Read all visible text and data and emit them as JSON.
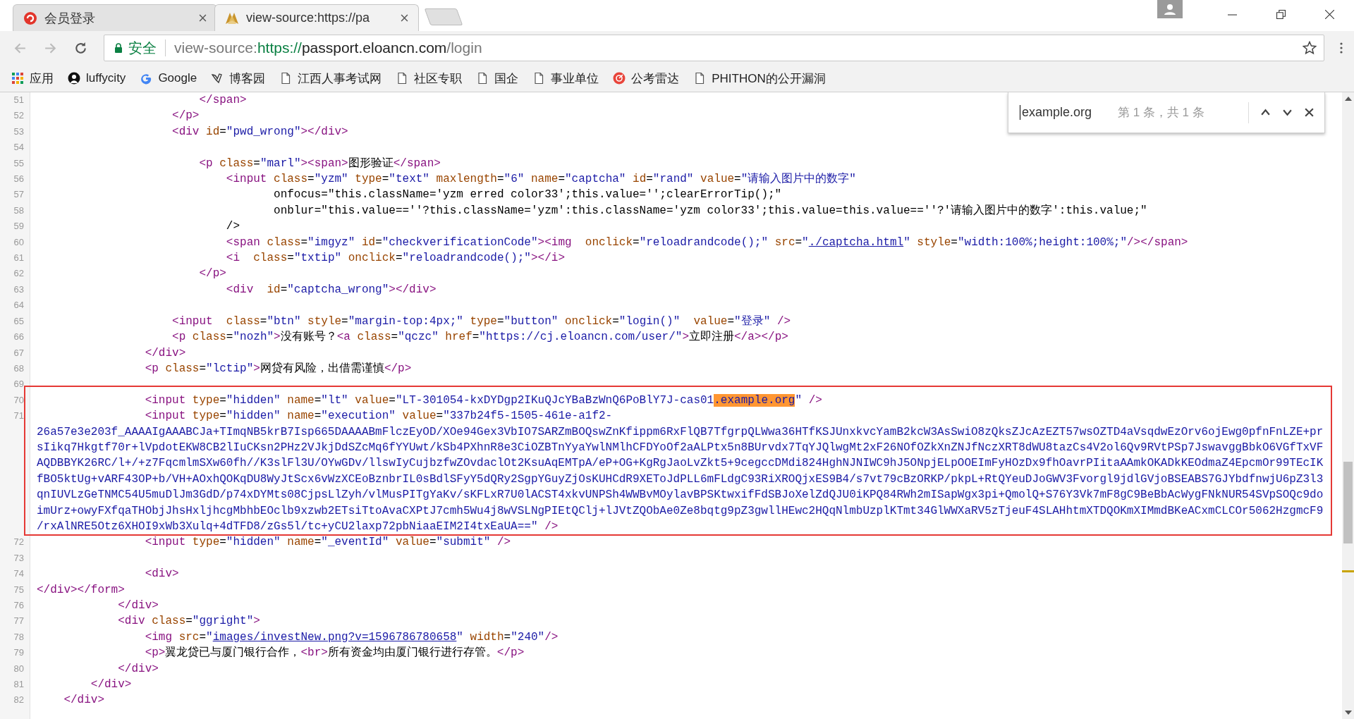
{
  "tabs": [
    {
      "title": "会员登录",
      "selected": false
    },
    {
      "title": "view-source:https://pa",
      "selected": true
    }
  ],
  "address_bar": {
    "security": "安全",
    "url": [
      {
        "kind": "prefix",
        "text": "view-source:"
      },
      {
        "kind": "scheme",
        "text": "https://"
      },
      {
        "kind": "host",
        "text": "passport.eloancn.com"
      },
      {
        "kind": "path",
        "text": "/login"
      }
    ]
  },
  "bookmarks": [
    {
      "label": "应用",
      "kind": "apps"
    },
    {
      "label": "luffycity",
      "kind": "person"
    },
    {
      "label": "Google",
      "kind": "google"
    },
    {
      "label": "博客园",
      "kind": "bird"
    },
    {
      "label": "江西人事考试网",
      "kind": "page"
    },
    {
      "label": "社区专职",
      "kind": "page"
    },
    {
      "label": "国企",
      "kind": "page"
    },
    {
      "label": "事业单位",
      "kind": "page"
    },
    {
      "label": "公考雷达",
      "kind": "radar"
    },
    {
      "label": "PHITHON的公开漏洞",
      "kind": "page"
    }
  ],
  "find_bar": {
    "query": "example.org",
    "count": "第 1 条，共 1 条"
  },
  "source_blocks": [
    {
      "framed": false,
      "lines": [
        {
          "num": "51",
          "text": "                        </span>"
        },
        {
          "num": "52",
          "text": "                    </p>"
        },
        {
          "num": "53",
          "text": "                    <div id=\"pwd_wrong\"></div>"
        },
        {
          "num": "54"
        },
        {
          "num": "55",
          "text": "                        <p class=\"marl\"><span>图形验证</span>"
        },
        {
          "num": "56",
          "text": "                            <input class=\"yzm\" type=\"text\" maxlength=\"6\" name=\"captcha\" id=\"rand\" value=\"请输入图片中的数字\""
        },
        {
          "num": "57",
          "text": "                                   onfocus=\"this.className='yzm erred color33';this.value='';clearErrorTip();\""
        },
        {
          "num": "58",
          "text": "                                   onblur=\"this.value==''?this.className='yzm':this.className='yzm color33';this.value=this.value==''?'请输入图片中的数字':this.value;\""
        },
        {
          "num": "59",
          "text": "                            />"
        },
        {
          "num": "60",
          "text": "                            <span class=\"imgyz\" id=\"checkverificationCode\"><img  onclick=\"reloadrandcode();\" src=\"",
          "link": "./captcha.html",
          "after": "\" style=\"width:100%;height:100%;\"/></span>"
        },
        {
          "num": "61",
          "text": "                            <i  class=\"txtip\" onclick=\"reloadrandcode();\"></i>"
        },
        {
          "num": "62",
          "text": "                        </p>"
        },
        {
          "num": "63",
          "text": "                            <div  id=\"captcha_wrong\"></div>"
        },
        {
          "num": "64"
        },
        {
          "num": "65",
          "text": "                    <input  class=\"btn\" style=\"margin-top:4px;\" type=\"button\" onclick=\"login()\"  value=\"登录\" />"
        },
        {
          "num": "66",
          "text": "                    <p class=\"nozh\">没有账号？<a class=\"qczc\" href=\"https://cj.eloancn.com/user/\">立即注册</a></p>"
        },
        {
          "num": "67",
          "text": "                </div>"
        },
        {
          "num": "68",
          "text": "                <p class=\"lctip\">网贷有风险，出借需谨慎</p>"
        },
        {
          "num": "69"
        }
      ]
    },
    {
      "framed": true,
      "lines": [
        {
          "num": "70",
          "text": "                <input type=\"hidden\" name=\"lt\" value=\"LT-301054-kxDYDgp2IKuQJcYBaBzWnQ6PoBlY7J-cas01",
          "match": ".example.org",
          "after": "\" />"
        },
        {
          "num": "71",
          "text": "                <input type=\"hidden\" name=\"execution\" value=\"337b24f5-1505-461e-a1f2-26a57e3e203f_AAAAIgAAABCJa+TImqNB5krB7Isp665DAAAABmFlczEyOD/XOe94Gex3VbIO7SARZmBOQswZnKfippm6RxFlQB7TfgrpQLWwa36HTfKSJUnxkvcYamB2kcW3AsSwiO8zQksZJcAzEZT57wsOZTD4aVsqdwEzOrv6ojEwg0pfnFnLZE+prsIikq7Hkgtf70r+lVpdotEKW8CB2lIuCKsn2PHz2VJkjDdSZcMq6fYYUwt/kSb4PXhnR8e3CiOZBTnYyaYwlNMlhCFDYoOf2aALPtx5n8BUrvdx7TqYJQlwgMt2xF26NOfOZkXnZNJfNczXRT8dWU8tazCs4V2ol6Qv9RVtPSp7JswavggBbkO6VGfTxVFAQDBBYK26RC/l+/+z7FqcmlmSXw60fh//K3slFl3U/OYwGDv/llswIyCujbzfwZOvdaclOt2KsuAqEMTpA/eP+OG+KgRgJaoLvZkt5+9cegccDMdi824HghNJNIWC9hJ5ONpjELpOOEImFyHOzDx9fhOavrPIitaAAmkOKADkKEOdmaZ4EpcmOr99TEcIKfBO5ktUg+vARF43OP+b/VH+AOxhQOKqDU8WyJtScx6vWzXCEoBznbrIL0sBdlSFyY5dQRy2SgpYGuyZjOsKUHCdR9XEToJdPLL6mFLdgC93RiXROQjxES9B4/s7vt79cBzORKP/pkpL+RtQYeuDJoGWV3Fvorgl9jdlGVjoBSEABS7GJYbdfnwjU6pZ3l3qnIUVLzGeTNMC54U5muDlJm3GdD/p74xDYMts08CjpsLlZyh/vlMusPITgYaKv/sKFLxR7U0lACST4xkvUNPSh4WWBvMOylavBPSKtwxifFdSBJoXelZdQJU0iKPQ84RWh2mISapWgx3pi+QmolQ+S76Y3Vk7mF8gC9BeBbAcWygFNkNUR54SVpSOQc9doimUrz+owyFXfqaTHObjJhsHxljhcgMbhbEOclb9xzwb2ETsiTtoAvaCXPtJ7cmh5Wu4j8wVSLNgPIEtQClj+lJVtZQObAe0Ze8bqtg9pZ3gwllHEwc2HQqNlmbUzplKTmt34GlWWXaRV5zTjeuF4SLAHhtmXTDQOKmXIMmdBKeACxmCLCOr5062HzgmcF9/rxAlNRE5Otz6XHOI9xWb3Xulq+4dTFD8/zGs5l/tc+yCU2laxp72pbNiaaEIM2I4txEaUA==\" />"
        }
      ]
    },
    {
      "framed": false,
      "lines": [
        {
          "num": "72",
          "text": "                <input type=\"hidden\" name=\"_eventId\" value=\"submit\" />"
        },
        {
          "num": "73"
        },
        {
          "num": "74",
          "text": "                <div>"
        },
        {
          "num": "75",
          "text": "</div></form>"
        },
        {
          "num": "76",
          "text": "            </div>"
        },
        {
          "num": "77",
          "text": "            <div class=\"ggright\">"
        },
        {
          "num": "78",
          "text": "                <img src=\"",
          "link": "images/investNew.png?v=1596786780658",
          "after": "\" width=\"240\"/>"
        },
        {
          "num": "79",
          "text": "                <p>翼龙贷已与厦门银行合作，<br>所有资金均由厦门银行进行存管。</p>"
        },
        {
          "num": "80",
          "text": "            </div>"
        },
        {
          "num": "81",
          "text": "        </div>"
        },
        {
          "num": "82",
          "text": "    </div>"
        }
      ]
    }
  ]
}
